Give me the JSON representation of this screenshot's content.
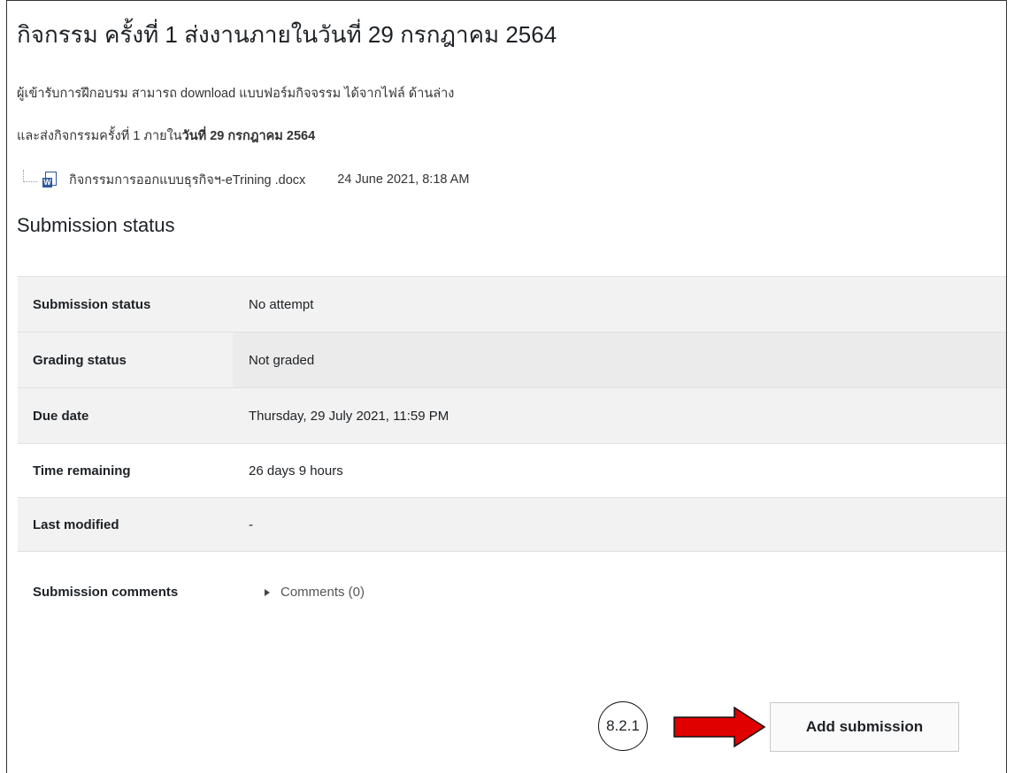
{
  "activity": {
    "title": "กิจกรรม ครั้งที่ 1 ส่งงานภายในวันที่ 29 กรกฎาคม 2564",
    "intro_line_1": "ผู้เข้ารับการฝึกอบรม สามารถ download แบบฟอร์มกิจจรรม ได้จากไฟล์ ด้านล่าง",
    "intro_line_2_prefix": "และส่งกิจกรรมครั้งที่ 1 ภายใน",
    "intro_line_2_bold": "วันที่ 29 กรกฎาคม 2564"
  },
  "attachment": {
    "icon": "word-document-icon",
    "filename": "กิจกรรมการออกแบบธุรกิจฯ-eTrining .docx",
    "uploaded": "24 June 2021, 8:18 AM"
  },
  "submission": {
    "heading": "Submission status",
    "rows": [
      {
        "label": "Submission status",
        "value": "No attempt"
      },
      {
        "label": "Grading status",
        "value": "Not graded"
      },
      {
        "label": "Due date",
        "value": "Thursday, 29 July 2021, 11:59 PM"
      },
      {
        "label": "Time remaining",
        "value": "26 days 9 hours"
      },
      {
        "label": "Last modified",
        "value": "-"
      },
      {
        "label": "Submission comments",
        "value": "Comments (0)"
      }
    ]
  },
  "annotation": {
    "step_label": "8.2.1",
    "arrow_color": "#e00000"
  },
  "actions": {
    "add_submission": "Add submission"
  }
}
